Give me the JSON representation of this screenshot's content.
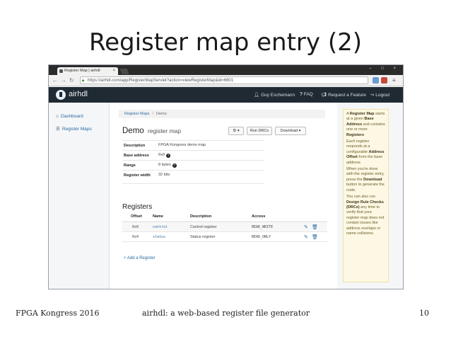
{
  "slide": {
    "title": "Register map entry (2)",
    "footer_left": "FPGA Kongress 2016",
    "footer_center": "airhdl: a web-based register file generator",
    "footer_right": "10"
  },
  "browser": {
    "tab_title": "Register Map | airhdl",
    "tab_close": "×",
    "url": "https://airhdl.com/app/RegisterMapServlet?action=viewRegisterMap&id=6601",
    "window_controls": "– □ ×"
  },
  "navbar": {
    "brand": "airhdl",
    "user": "Guy Eschemann",
    "faq": "FAQ",
    "feature": "Request a Feature",
    "logout": "Logout"
  },
  "sidebar": {
    "items": [
      {
        "label": "Dashboard"
      },
      {
        "label": "Register Maps"
      }
    ]
  },
  "breadcrumb": {
    "root": "Register Maps",
    "sep": "/",
    "current": "Demo"
  },
  "page": {
    "name": "Demo",
    "kind": "register map",
    "settings_label": "⚙ ▾",
    "run_drcs": "Run DRCs",
    "download": "Download ▾"
  },
  "properties": [
    {
      "key": "Description",
      "value": "FPGA Kongress demo map"
    },
    {
      "key": "Base address",
      "value": "0x0"
    },
    {
      "key": "Range",
      "value": "8 bytes"
    },
    {
      "key": "Register width",
      "value": "32 bits"
    }
  ],
  "registers": {
    "title": "Registers",
    "headers": {
      "offset": "Offset",
      "name": "Name",
      "description": "Description",
      "access": "Access"
    },
    "rows": [
      {
        "offset": "0x0",
        "name": "control",
        "description": "Control register",
        "access": "READ_WRITE"
      },
      {
        "offset": "0x4",
        "name": "status",
        "description": "Status register",
        "access": "READ_ONLY"
      }
    ],
    "add_label": "Add a Register"
  },
  "help": {
    "p1_a": "A ",
    "p1_b": "Register Map",
    "p1_c": " starts at a given ",
    "p1_d": "Base Address",
    "p1_e": " and contains one or more ",
    "p1_f": "Registers",
    "p2_a": "Each register responds at a configurable ",
    "p2_b": "Address Offset",
    "p2_c": " from the base address.",
    "p3_a": "When you're done with the register entry, press the ",
    "p3_b": "Download",
    "p3_c": " button to generate the code.",
    "p4_a": "You can also run ",
    "p4_b": "Design Rule Checks (DRCs)",
    "p4_c": " any time to verify that your register map does not contain issues like address overlaps or name collisions."
  },
  "colors": {
    "navbar": "#1f2a33",
    "link": "#2b6ca3",
    "help_bg": "#fcf8e3"
  }
}
